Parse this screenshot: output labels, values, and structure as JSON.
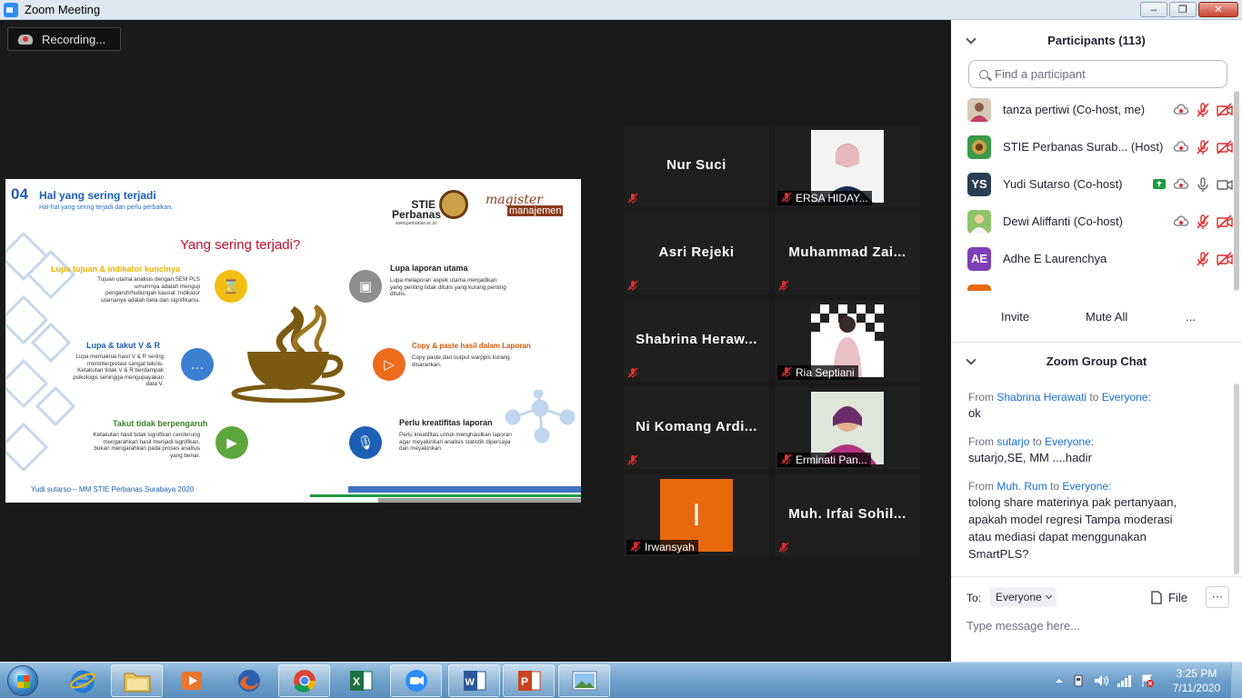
{
  "window": {
    "title": "Zoom Meeting",
    "min_label": "–",
    "max_label": "❐",
    "close_label": "✕"
  },
  "recording": {
    "label": "Recording..."
  },
  "slide": {
    "number": "04",
    "heading": "Hal yang sering terjadi",
    "subheading": "Hal-hal yang sering terjadi dan perlu perbaikan.",
    "logo_stie_line1": "STIE",
    "logo_stie_line2": "Perbanas",
    "logo_stie_url": "www.perbanas.ac.id",
    "logo_mm_line1": "magister",
    "logo_mm_line2": "manajemen",
    "center_title": "Yang sering terjadi?",
    "items": [
      {
        "title": "Lupa tujuan & indikator kuncinya",
        "desc": "Tujuan utama analisis dengan SEM PLS umumnya adalah menguji pengaruh/hubungan kausal. Indikator utamanya adalah beta dan signifikansi.",
        "color": "#e8b400"
      },
      {
        "title": "Lupa & takut V & R",
        "desc": "Lupa memaknai hasil V & R sering meninterpretasi sangat teknis. Ketakutan tidak V & R berdampak psikologis sehingga mengupayakan data V.",
        "color": "#1d5fb4"
      },
      {
        "title": "Takut tidak berpengaruh",
        "desc": "Ketakutan hasil tidak signifikan cenderung mengarahkan hasil menjadi signifikan, bukan mengarahkan pada proses analisis yang benar.",
        "color": "#3f7b2f"
      },
      {
        "title": "Lupa laporan utama",
        "desc": "Lupa melaporan aspek utama menjadikan yang penting tidak ditulis yang kurang penting ditulis.",
        "color": "#222222"
      },
      {
        "title": "Copy & paste hasil dalam Laporan",
        "desc": "Copy paste dari output warppls kurang disarankan.",
        "color": "#d4570c"
      },
      {
        "title": "Perlu kreatifitas laporan",
        "desc": "Perlu kreatifitas untuk menghasilkan laporan agar meyakinkan analisis statistik dipercaya dan meyakinkan.",
        "color": "#222222"
      }
    ],
    "footer": "Yudi sutarso – MM STIE Perbanas Surabaya 2020"
  },
  "tiles": [
    {
      "name": "Nur Suci",
      "label": "",
      "photo": false
    },
    {
      "name": "",
      "label": "ERSA HIDAY...",
      "photo": true
    },
    {
      "name": "Asri Rejeki",
      "label": "",
      "photo": false
    },
    {
      "name": "Muhammad  Zai...",
      "label": "",
      "photo": false
    },
    {
      "name": "Shabrina  Heraw...",
      "label": "",
      "photo": false
    },
    {
      "name": "",
      "label": "Ria Septiani",
      "photo": true
    },
    {
      "name": "Ni Komang Ardi...",
      "label": "",
      "photo": false
    },
    {
      "name": "",
      "label": "Erminati Pan...",
      "photo": true
    },
    {
      "name": "",
      "label": "Irwansyah",
      "photo": false,
      "initial": "I",
      "initial_color": "#e8690c"
    },
    {
      "name": "Muh. Irfai Sohil...",
      "label": "",
      "photo": false
    }
  ],
  "participants": {
    "title": "Participants (113)",
    "search_placeholder": "Find a participant",
    "items": [
      {
        "name": "tanza pertiwi (Co-host, me)",
        "avatar_initials": "",
        "avatar_color": "#c9b8a6"
      },
      {
        "name": "STIE Perbanas Surab...  (Host)",
        "avatar_initials": "",
        "avatar_color": "#2f8a3a"
      },
      {
        "name": "Yudi Sutarso (Co-host)",
        "avatar_initials": "YS",
        "avatar_color": "#2b3d52"
      },
      {
        "name": "Dewi Aliffanti (Co-host)",
        "avatar_initials": "",
        "avatar_color": "#6fae4a"
      },
      {
        "name": "Adhe E Laurenchya",
        "avatar_initials": "AE",
        "avatar_color": "#7d3fb7"
      }
    ],
    "invite_label": "Invite",
    "mute_all_label": "Mute All",
    "more_label": "..."
  },
  "chat": {
    "title": "Zoom Group Chat",
    "messages": [
      {
        "from_label": "From",
        "sender": "Shabrina Herawati",
        "to_label": "to",
        "recipient": "Everyone:",
        "text": "ok"
      },
      {
        "from_label": "From",
        "sender": "sutarjo",
        "to_label": "to",
        "recipient": "Everyone:",
        "text": "sutarjo,SE, MM ....hadir"
      },
      {
        "from_label": "From",
        "sender": "Muh. Rum",
        "to_label": "to",
        "recipient": "Everyone:",
        "text": "tolong share materinya pak pertanyaan, apakah model regresi Tampa moderasi atau mediasi dapat menggunakan SmartPLS?"
      }
    ],
    "to_label": "To:",
    "to_value": "Everyone",
    "file_label": "File",
    "more_label": "⋯",
    "input_placeholder": "Type message here..."
  },
  "taskbar": {
    "apps": [
      "internet-explorer",
      "file-explorer",
      "media-player",
      "firefox",
      "chrome",
      "excel",
      "zoom",
      "word",
      "powerpoint",
      "photo-viewer"
    ],
    "time": "3:25 PM",
    "date": "7/11/2020"
  },
  "colors": {
    "zoom_blue": "#2d8cff",
    "link_blue": "#1c6fd1",
    "mute_red": "#e02d2d",
    "share_green": "#1e9a44"
  }
}
